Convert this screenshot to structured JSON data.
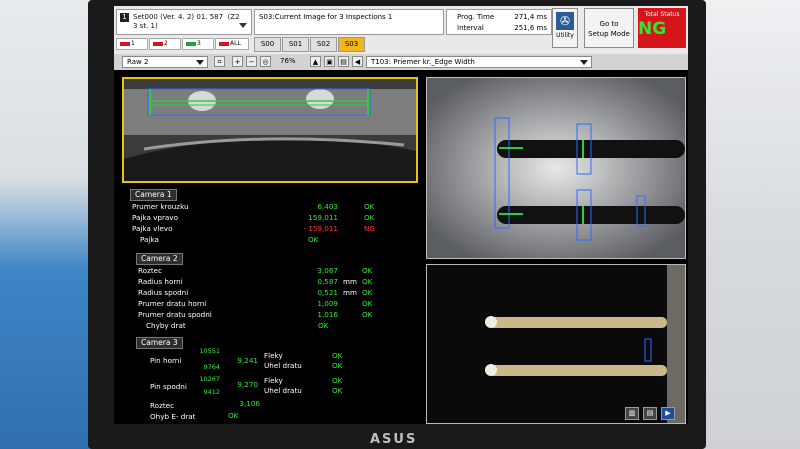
{
  "header": {
    "set_number": "1",
    "set_line1": "Set000 (Ver. 4. 2) 01. 587",
    "set_line2": "3 st. 1)",
    "set_zone": "(Z2",
    "inspection_title": "S03:Current Image for 3 Inspections 1",
    "prog_time_label": "Prog. Time",
    "prog_time_value": "271,4 ms",
    "interval_label": "Interval",
    "interval_value": "251,6 ms",
    "utility_label": "Utility",
    "setup_label_1": "Go to",
    "setup_label_2": "Setup Mode",
    "status_label": "Total Status",
    "status_value": "NG"
  },
  "camera_tabs": [
    {
      "label": "1",
      "color": "#d6141b"
    },
    {
      "label": "2",
      "color": "#d6141b"
    },
    {
      "label": "3",
      "color": "#19a33a"
    },
    {
      "label": "ALL",
      "color": "#d6141b"
    }
  ],
  "screen_tabs": [
    "S00",
    "S01",
    "S02",
    "S03"
  ],
  "active_screen_tab": "S03",
  "toolbar": {
    "image_select": "Raw 2",
    "zoom": "76%",
    "tool_select": "T103: Priemer kr._Edge Width"
  },
  "camera1": {
    "title": "Camera 1",
    "rows": [
      {
        "label": "Prumer krouzku",
        "value": "6,403",
        "status": "OK"
      },
      {
        "label": "Pajka vpravo",
        "value": "159,011",
        "status": "OK"
      },
      {
        "label": "Pajka vlevo",
        "value": "- 159,011",
        "status": "NG"
      },
      {
        "label": "Pajka",
        "value": "",
        "status": "OK"
      }
    ]
  },
  "camera2": {
    "title": "Camera 2",
    "rows": [
      {
        "label": "Roztec",
        "value": "3,067",
        "unit": "",
        "status": "OK"
      },
      {
        "label": "Radius horni",
        "value": "0,587",
        "unit": "mm",
        "status": "OK"
      },
      {
        "label": "Radius spodni",
        "value": "0,521",
        "unit": "mm",
        "status": "OK"
      },
      {
        "label": "Prumer dratu horni",
        "value": "1,009",
        "unit": "",
        "status": "OK"
      },
      {
        "label": "Prumer dratu spodni",
        "value": "1,016",
        "unit": "",
        "status": "OK"
      },
      {
        "label": "Chyby drat",
        "value": "",
        "unit": "",
        "status": "OK"
      }
    ]
  },
  "camera3": {
    "title": "Camera 3",
    "pin_horni": {
      "label": "Pin horni",
      "top": "10551",
      "bottom": "9764",
      "mid": "9,241",
      "flek_label": "Fleky",
      "flek_status": "OK",
      "uhel_label": "Uhel dratu",
      "uhel_status": "OK"
    },
    "pin_spodni": {
      "label": "Pin spodni",
      "top": "10267",
      "bottom": "9412",
      "mid": "9,270",
      "flek_label": "Fleky",
      "flek_status": "OK",
      "uhel_label": "Uhel dratu",
      "uhel_status": "OK"
    },
    "roztec": {
      "label": "Roztec",
      "value": "3,106"
    },
    "ohyb": {
      "label": "Ohyb E- drat",
      "status": "OK"
    }
  },
  "monitor_brand": "ASUS"
}
